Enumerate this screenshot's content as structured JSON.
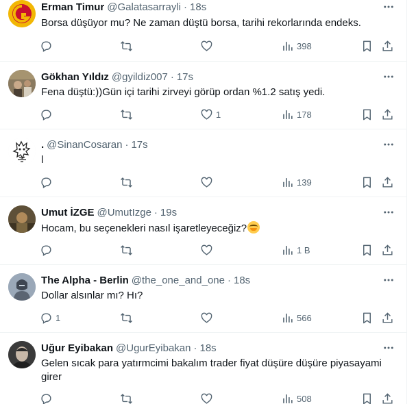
{
  "tweets": [
    {
      "name": "Erman Timur",
      "handle": "@Galatasarrayli",
      "time": "18s",
      "text": "Borsa düşüyor mu? Ne zaman düştü borsa, tarihi rekorlarında endeks.",
      "replies": "",
      "retweets": "",
      "likes": "",
      "views": "398",
      "avatar_icon": "galatasaray-logo-icon",
      "avatar_color": "#f2b705"
    },
    {
      "name": "Gökhan Yıldız",
      "handle": "@gyildiz007",
      "time": "17s",
      "text": "Fena düştü:))Gün içi tarihi zirveyi görüp ordan  %1.2 satış yedi.",
      "replies": "",
      "retweets": "",
      "likes": "1",
      "views": "178",
      "avatar_icon": "photo-avatar-icon",
      "avatar_color": "#7a6a55"
    },
    {
      "name": ".",
      "handle": "@SinanCosaran",
      "time": "17s",
      "text": "l",
      "replies": "",
      "retweets": "",
      "likes": "",
      "views": "139",
      "avatar_icon": "cartoon-sketch-icon",
      "avatar_color": "#f5f5f5"
    },
    {
      "name": "Umut İZGE",
      "handle": "@UmutIzge",
      "time": "19s",
      "text": "Hocam, bu seçenekleri nasıl işaretleyeceğiz?",
      "emoji": "😊",
      "replies": "",
      "retweets": "",
      "likes": "",
      "views": "1 B",
      "avatar_icon": "photo-avatar-icon",
      "avatar_color": "#6b5a3a"
    },
    {
      "name": "The Alpha - Berlin",
      "handle": "@the_one_and_one",
      "time": "18s",
      "text": "Dollar alsınlar mı? Hı?",
      "replies": "1",
      "retweets": "",
      "likes": "",
      "views": "566",
      "avatar_icon": "armored-figure-icon",
      "avatar_color": "#8796a8"
    },
    {
      "name": "Uğur Eyibakan",
      "handle": "@UgurEyibakan",
      "time": "18s",
      "text": "Gelen sıcak para yatırmcimi bakalım trader fiyat düşüre düşüre piyasayami girer",
      "replies": "",
      "retweets": "",
      "likes": "",
      "views": "508",
      "avatar_icon": "portrait-photo-icon",
      "avatar_color": "#5a5a5a"
    }
  ],
  "colors": {
    "text_primary": "#0f1419",
    "text_secondary": "#536471",
    "divider": "#eff3f4"
  }
}
